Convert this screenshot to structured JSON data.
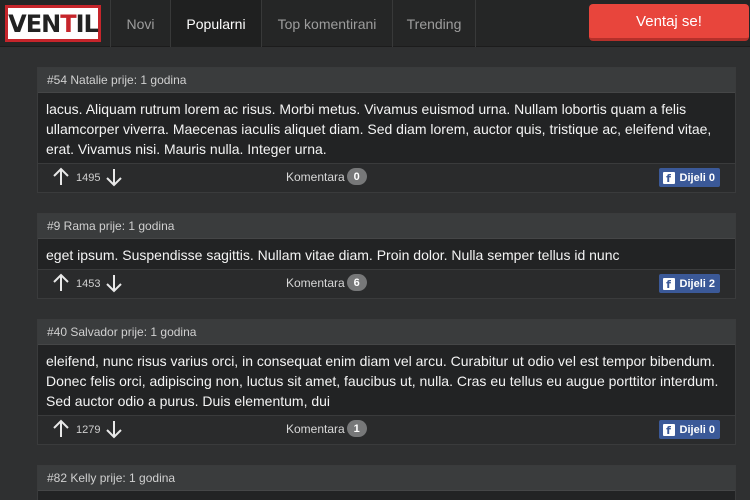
{
  "nav": {
    "logo": {
      "part1": "VEN",
      "part2": "T",
      "part3": "IL"
    },
    "tabs": [
      {
        "label": "Novi"
      },
      {
        "label": "Popularni"
      },
      {
        "label": "Top komentirani"
      },
      {
        "label": "Trending"
      }
    ],
    "vent_button": "Ventaj se!"
  },
  "posts": [
    {
      "header": "#54 Natalie prije: 1 godina",
      "text": "lacus. Aliquam rutrum lorem ac risus. Morbi metus. Vivamus euismod urna. Nullam lobortis quam a felis ullamcorper viverra. Maecenas iaculis aliquet diam. Sed diam lorem, auctor quis, tristique ac, eleifend vitae, erat. Vivamus nisi. Mauris nulla. Integer urna.",
      "votes": "1495",
      "comments_label": "Komentara",
      "comments": "0",
      "share": "Dijeli 0"
    },
    {
      "header": "#9 Rama prije: 1 godina",
      "text": "eget ipsum. Suspendisse sagittis. Nullam vitae diam. Proin dolor. Nulla semper tellus id nunc",
      "votes": "1453",
      "comments_label": "Komentara",
      "comments": "6",
      "share": "Dijeli 2"
    },
    {
      "header": "#40 Salvador prije: 1 godina",
      "text": "eleifend, nunc risus varius orci, in consequat enim diam vel arcu. Curabitur ut odio vel est tempor bibendum. Donec felis orci, adipiscing non, luctus sit amet, faucibus ut, nulla. Cras eu tellus eu augue porttitor interdum. Sed auctor odio a purus. Duis elementum, dui",
      "votes": "1279",
      "comments_label": "Komentara",
      "comments": "1",
      "share": "Dijeli 0"
    },
    {
      "header": "#82 Kelly prije: 1 godina"
    }
  ],
  "colors": {
    "accent": "#e8453c",
    "facebook": "#3b5998",
    "logo_red": "#c6252b"
  },
  "icons": [
    "arrow-up-icon",
    "arrow-down-icon",
    "facebook-icon"
  ]
}
